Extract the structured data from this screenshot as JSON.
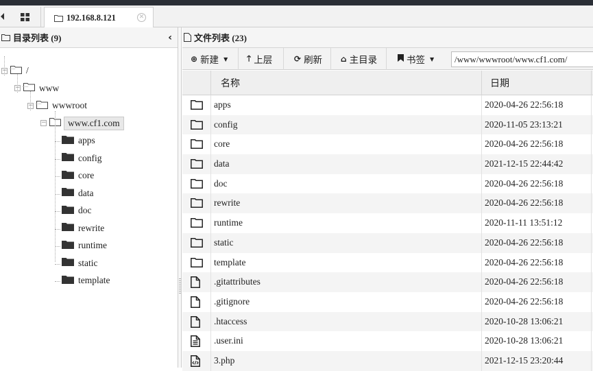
{
  "tab": {
    "host": "192.168.8.121"
  },
  "left_panel": {
    "title": "目录列表 (9)",
    "tree": [
      {
        "label": "/",
        "level": 0,
        "expanded": true
      },
      {
        "label": "www",
        "level": 1,
        "expanded": true
      },
      {
        "label": "wwwroot",
        "level": 2,
        "expanded": true
      },
      {
        "label": "www.cf1.com",
        "level": 3,
        "expanded": true,
        "selected": true
      },
      {
        "label": "apps",
        "level": 4
      },
      {
        "label": "config",
        "level": 4
      },
      {
        "label": "core",
        "level": 4
      },
      {
        "label": "data",
        "level": 4
      },
      {
        "label": "doc",
        "level": 4
      },
      {
        "label": "rewrite",
        "level": 4
      },
      {
        "label": "runtime",
        "level": 4
      },
      {
        "label": "static",
        "level": 4
      },
      {
        "label": "template",
        "level": 4
      }
    ]
  },
  "right_panel": {
    "title": "文件列表 (23)",
    "toolbar": {
      "new_label": "新建",
      "up_label": "上层",
      "refresh_label": "刷新",
      "home_label": "主目录",
      "bookmark_label": "书签",
      "path_value": "/www/wwwroot/www.cf1.com/"
    },
    "columns": {
      "name": "名称",
      "date": "日期"
    },
    "files": [
      {
        "name": "apps",
        "date": "2020-04-26 22:56:18",
        "type": "folder"
      },
      {
        "name": "config",
        "date": "2020-11-05 23:13:21",
        "type": "folder"
      },
      {
        "name": "core",
        "date": "2020-04-26 22:56:18",
        "type": "folder"
      },
      {
        "name": "data",
        "date": "2021-12-15 22:44:42",
        "type": "folder"
      },
      {
        "name": "doc",
        "date": "2020-04-26 22:56:18",
        "type": "folder"
      },
      {
        "name": "rewrite",
        "date": "2020-04-26 22:56:18",
        "type": "folder"
      },
      {
        "name": "runtime",
        "date": "2020-11-11 13:51:12",
        "type": "folder"
      },
      {
        "name": "static",
        "date": "2020-04-26 22:56:18",
        "type": "folder"
      },
      {
        "name": "template",
        "date": "2020-04-26 22:56:18",
        "type": "folder"
      },
      {
        "name": ".gitattributes",
        "date": "2020-04-26 22:56:18",
        "type": "file"
      },
      {
        "name": ".gitignore",
        "date": "2020-04-26 22:56:18",
        "type": "file"
      },
      {
        "name": ".htaccess",
        "date": "2020-10-28 13:06:21",
        "type": "file"
      },
      {
        "name": ".user.ini",
        "date": "2020-10-28 13:06:21",
        "type": "text"
      },
      {
        "name": "3.php",
        "date": "2021-12-15 23:20:44",
        "type": "code"
      }
    ]
  }
}
